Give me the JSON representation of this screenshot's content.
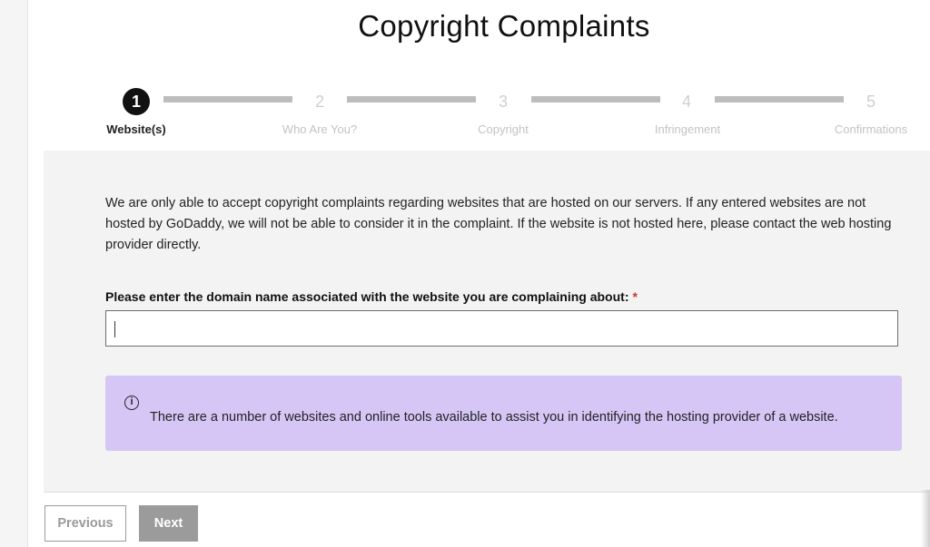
{
  "page": {
    "title": "Copyright Complaints"
  },
  "stepper": {
    "steps": [
      {
        "number": "1",
        "label": "Website(s)",
        "active": true
      },
      {
        "number": "2",
        "label": "Who Are You?",
        "active": false
      },
      {
        "number": "3",
        "label": "Copyright",
        "active": false
      },
      {
        "number": "4",
        "label": "Infringement",
        "active": false
      },
      {
        "number": "5",
        "label": "Confirmations",
        "active": false
      }
    ]
  },
  "form": {
    "intro_text": "We are only able to accept copyright complaints regarding websites that are hosted on our servers. If any entered websites are not hosted by GoDaddy, we will not be able to consider it in the complaint. If the website is not hosted here, please contact the web hosting provider directly.",
    "domain_label": "Please enter the domain name associated with the website you are complaining about:",
    "required_marker": "*",
    "domain_value": "",
    "info_icon": "info-circle-icon",
    "info_glyph": "i",
    "info_text": "There are a number of websites and online tools available to assist you in identifying the hosting provider of a website."
  },
  "footer": {
    "previous_label": "Previous",
    "next_label": "Next"
  },
  "colors": {
    "info_box_bg": "#d6c6f6",
    "active_step": "#111111",
    "required_star": "#d0342c",
    "disabled_button": "#9b9b9b"
  }
}
